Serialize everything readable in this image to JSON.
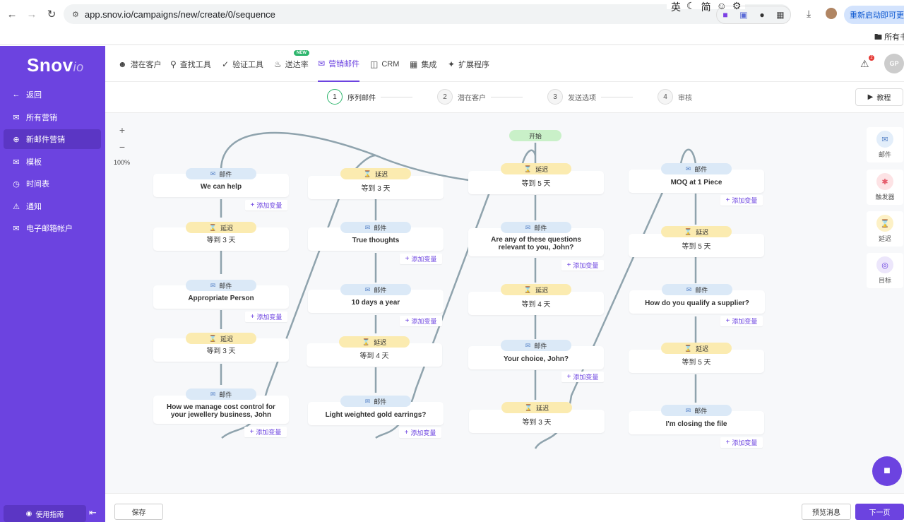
{
  "browser": {
    "url": "app.snov.io/campaigns/new/create/0/sequence",
    "restart_label": "重新启动即可更新",
    "bookmark_folder": "所有书",
    "ime": [
      "英",
      "简"
    ]
  },
  "sidebar": {
    "logo_main": "Snov",
    "logo_suffix": "io",
    "items": [
      {
        "label": "返回",
        "icon": "arrow-left-icon"
      },
      {
        "label": "所有营销",
        "icon": "mail-icon"
      },
      {
        "label": "新邮件营销",
        "icon": "plus-circle-icon"
      },
      {
        "label": "模板",
        "icon": "mail-icon"
      },
      {
        "label": "时间表",
        "icon": "clock-icon"
      },
      {
        "label": "通知",
        "icon": "bell-icon"
      },
      {
        "label": "电子邮箱帐户",
        "icon": "mail-icon"
      }
    ],
    "guide_label": "使用指南"
  },
  "topnav": {
    "items": [
      {
        "label": "潜在客户",
        "icon": "users-icon"
      },
      {
        "label": "查找工具",
        "icon": "search-icon"
      },
      {
        "label": "验证工具",
        "icon": "check-circle-icon"
      },
      {
        "label": "送达率",
        "icon": "flame-icon"
      },
      {
        "label": "营销邮件",
        "icon": "mail-icon"
      },
      {
        "label": "CRM",
        "icon": "crm-icon"
      },
      {
        "label": "集成",
        "icon": "grid-icon"
      },
      {
        "label": "扩展程序",
        "icon": "puzzle-icon"
      }
    ],
    "new_badge": "NEW",
    "notification_count": "2",
    "avatar_initials": "GP"
  },
  "stepper": {
    "steps": [
      {
        "num": "1",
        "label": "序列邮件"
      },
      {
        "num": "2",
        "label": "潜在客户"
      },
      {
        "num": "3",
        "label": "发送选项"
      },
      {
        "num": "4",
        "label": "审核"
      }
    ],
    "tutorial_label": "教程"
  },
  "canvas": {
    "zoom_in": "+",
    "zoom_out": "−",
    "zoom_level": "100%",
    "labels": {
      "mail": "邮件",
      "delay": "延迟",
      "start": "开始",
      "add_variable": "添加变量"
    },
    "columns": [
      {
        "nodes": [
          {
            "type": "mail",
            "text": "We can help"
          },
          {
            "type": "delay",
            "text": "等到 3 天"
          },
          {
            "type": "mail",
            "text": "Appropriate Person"
          },
          {
            "type": "delay",
            "text": "等到 3 天"
          },
          {
            "type": "mail",
            "text": "How we manage cost control for your jewellery business, John"
          }
        ]
      },
      {
        "nodes": [
          {
            "type": "delay",
            "text": "等到 3 天"
          },
          {
            "type": "mail",
            "text": "True thoughts"
          },
          {
            "type": "mail",
            "text": "10 days a year"
          },
          {
            "type": "delay",
            "text": "等到 4 天"
          },
          {
            "type": "mail",
            "text": "Light weighted gold earrings?"
          }
        ]
      },
      {
        "nodes": [
          {
            "type": "delay",
            "text": "等到 5 天"
          },
          {
            "type": "mail",
            "text": "Are any of these questions relevant to you, John?"
          },
          {
            "type": "delay",
            "text": "等到 4 天"
          },
          {
            "type": "mail",
            "text": "Your choice, John?"
          },
          {
            "type": "delay",
            "text": "等到 3 天"
          }
        ]
      },
      {
        "nodes": [
          {
            "type": "mail",
            "text": "MOQ at 1 Piece"
          },
          {
            "type": "delay",
            "text": "等到 5 天"
          },
          {
            "type": "mail",
            "text": "How do you qualify a supplier?"
          },
          {
            "type": "delay",
            "text": "等到 5 天"
          },
          {
            "type": "mail",
            "text": "I'm closing the file"
          }
        ]
      }
    ],
    "palette": [
      {
        "label": "邮件",
        "icon": "mail-icon",
        "color": "#e3eefa"
      },
      {
        "label": "触发器",
        "icon": "trigger-icon",
        "color": "#fde3e5"
      },
      {
        "label": "延迟",
        "icon": "hourglass-icon",
        "color": "#fdf1c6"
      },
      {
        "label": "目标",
        "icon": "target-icon",
        "color": "#ece6fb"
      }
    ]
  },
  "footer": {
    "save_label": "保存",
    "preview_label": "预览消息",
    "next_label": "下一页"
  },
  "colors": {
    "brand": "#6c43e0",
    "start_green": "#c9f0c8",
    "mail_blue": "#dbe9f7",
    "delay_yellow": "#fbebb0",
    "connector": "#8fa3ad"
  }
}
